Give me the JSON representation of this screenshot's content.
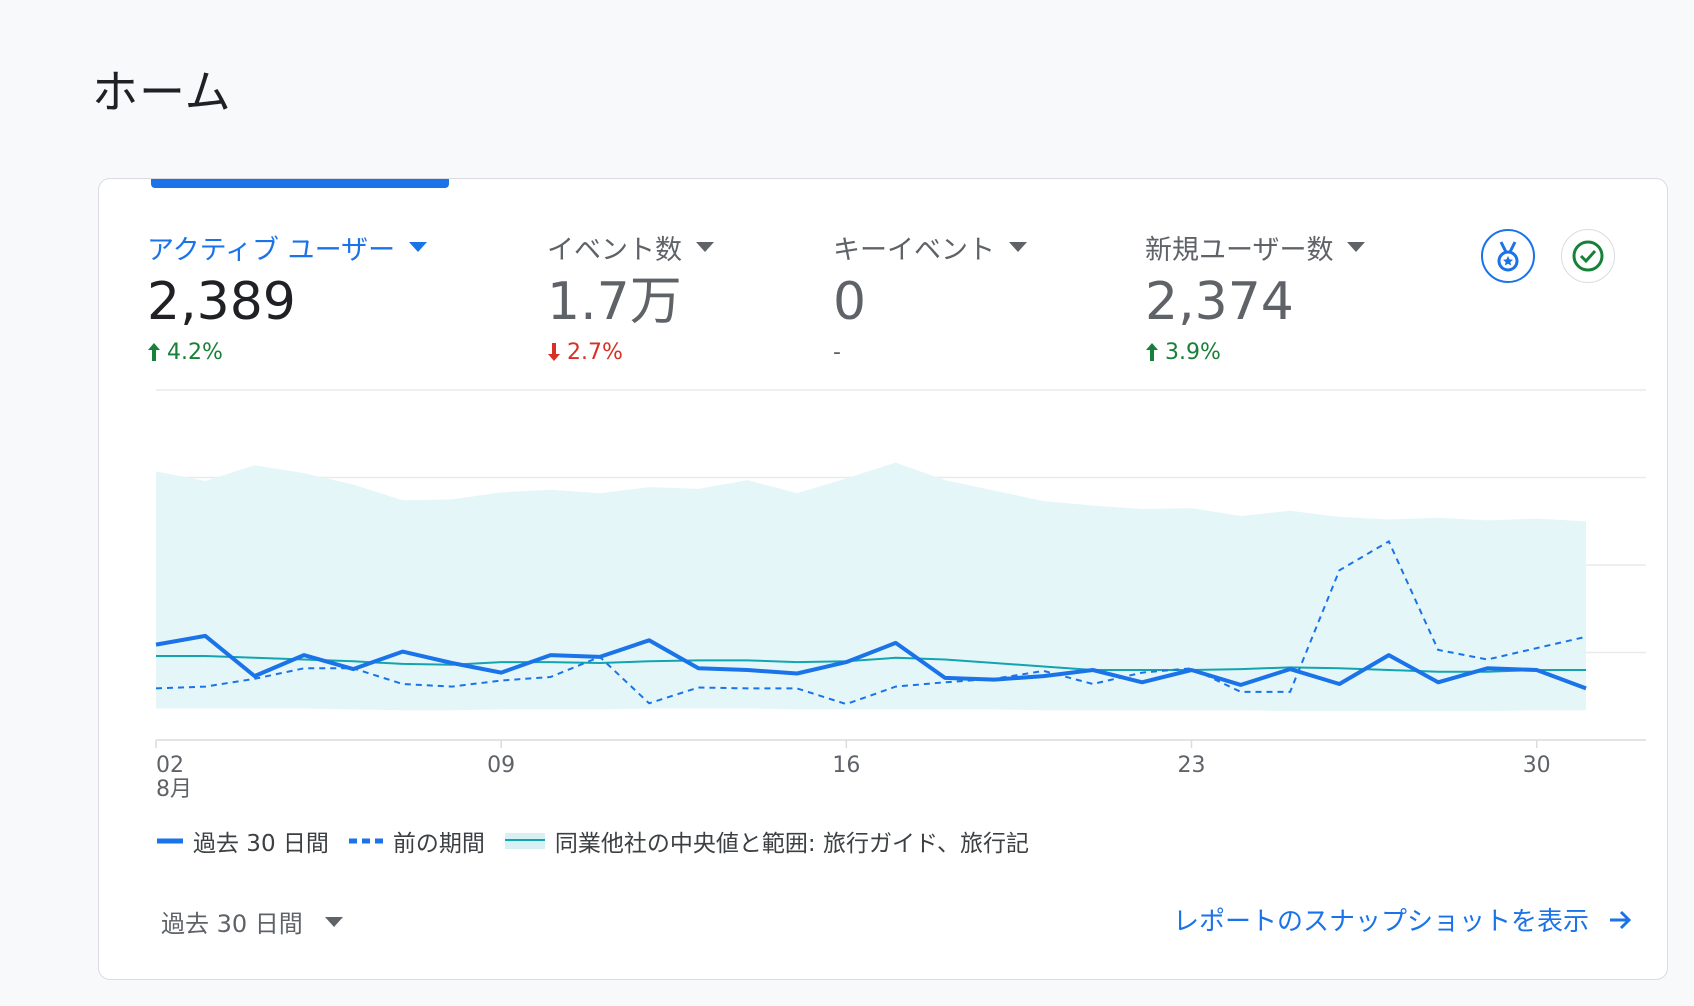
{
  "page": {
    "title": "ホーム"
  },
  "metrics": [
    {
      "label": "アクティブ ユーザー",
      "value": "2,389",
      "change": "4.2%",
      "direction": "up"
    },
    {
      "label": "イベント数",
      "value": "1.7万",
      "change": "2.7%",
      "direction": "down"
    },
    {
      "label": "キーイベント",
      "value": "0",
      "change": "-",
      "direction": "none"
    },
    {
      "label": "新規ユーザー数",
      "value": "2,374",
      "change": "3.9%",
      "direction": "up"
    }
  ],
  "icons": {
    "badge": "medal-badge-icon",
    "check": "check-circle-icon"
  },
  "colors": {
    "accent": "#1a73e8",
    "up": "#188038",
    "down": "#d93025",
    "benchmark": "#12a4af",
    "benchmark_fill": "#e4f5f8"
  },
  "chart_data": {
    "type": "line",
    "x": [
      "02",
      "03",
      "04",
      "05",
      "06",
      "07",
      "08",
      "09",
      "10",
      "11",
      "12",
      "13",
      "14",
      "15",
      "16",
      "17",
      "18",
      "19",
      "20",
      "21",
      "22",
      "23",
      "24",
      "25",
      "26",
      "27",
      "28",
      "29",
      "30",
      "31"
    ],
    "x_tick_labels": [
      "02",
      "09",
      "16",
      "23",
      "30"
    ],
    "x_month_label": "8月",
    "y_ticks": [
      "0",
      "100",
      "200",
      "300",
      "400"
    ],
    "ylim": [
      0,
      400
    ],
    "y_axis_side": "right",
    "grid": true,
    "series": [
      {
        "name": "過去 30 日間",
        "style": "solid",
        "values": [
          109,
          119,
          73,
          97,
          81,
          101,
          88,
          77,
          97,
          95,
          114,
          82,
          80,
          76,
          89,
          111,
          71,
          69,
          73,
          80,
          66,
          80,
          63,
          81,
          64,
          97,
          66,
          82,
          80,
          59
        ]
      },
      {
        "name": "前の期間",
        "style": "dashed",
        "values": [
          59,
          61,
          70,
          82,
          82,
          64,
          61,
          68,
          72,
          95,
          42,
          60,
          59,
          59,
          41,
          61,
          66,
          70,
          79,
          64,
          77,
          82,
          55,
          55,
          194,
          227,
          103,
          92,
          105,
          118
        ]
      },
      {
        "name": "同業他社の中央値と範囲: 旅行ガイド、旅行記",
        "style": "band",
        "median": [
          96,
          96,
          94,
          92,
          90,
          87,
          86,
          89,
          89,
          88,
          90,
          91,
          91,
          89,
          90,
          94,
          92,
          88,
          84,
          80,
          80,
          80,
          81,
          83,
          82,
          80,
          78,
          78,
          80,
          80
        ],
        "upper": [
          307,
          296,
          314,
          305,
          292,
          274,
          275,
          283,
          286,
          282,
          289,
          287,
          297,
          282,
          299,
          317,
          297,
          285,
          273,
          268,
          264,
          265,
          256,
          262,
          255,
          252,
          254,
          251,
          253,
          250
        ],
        "lower": [
          36,
          36,
          36,
          36,
          35,
          34,
          34,
          35,
          35,
          35,
          36,
          36,
          36,
          35,
          35,
          35,
          35,
          35,
          34,
          34,
          34,
          34,
          34,
          33,
          33,
          33,
          33,
          33,
          34,
          34
        ]
      }
    ]
  },
  "legend": [
    {
      "label": "過去 30 日間"
    },
    {
      "label": "前の期間"
    },
    {
      "label": "同業他社の中央値と範囲: 旅行ガイド、旅行記"
    }
  ],
  "footer": {
    "date_range": "過去 30 日間",
    "report_link": "レポートのスナップショットを表示"
  }
}
